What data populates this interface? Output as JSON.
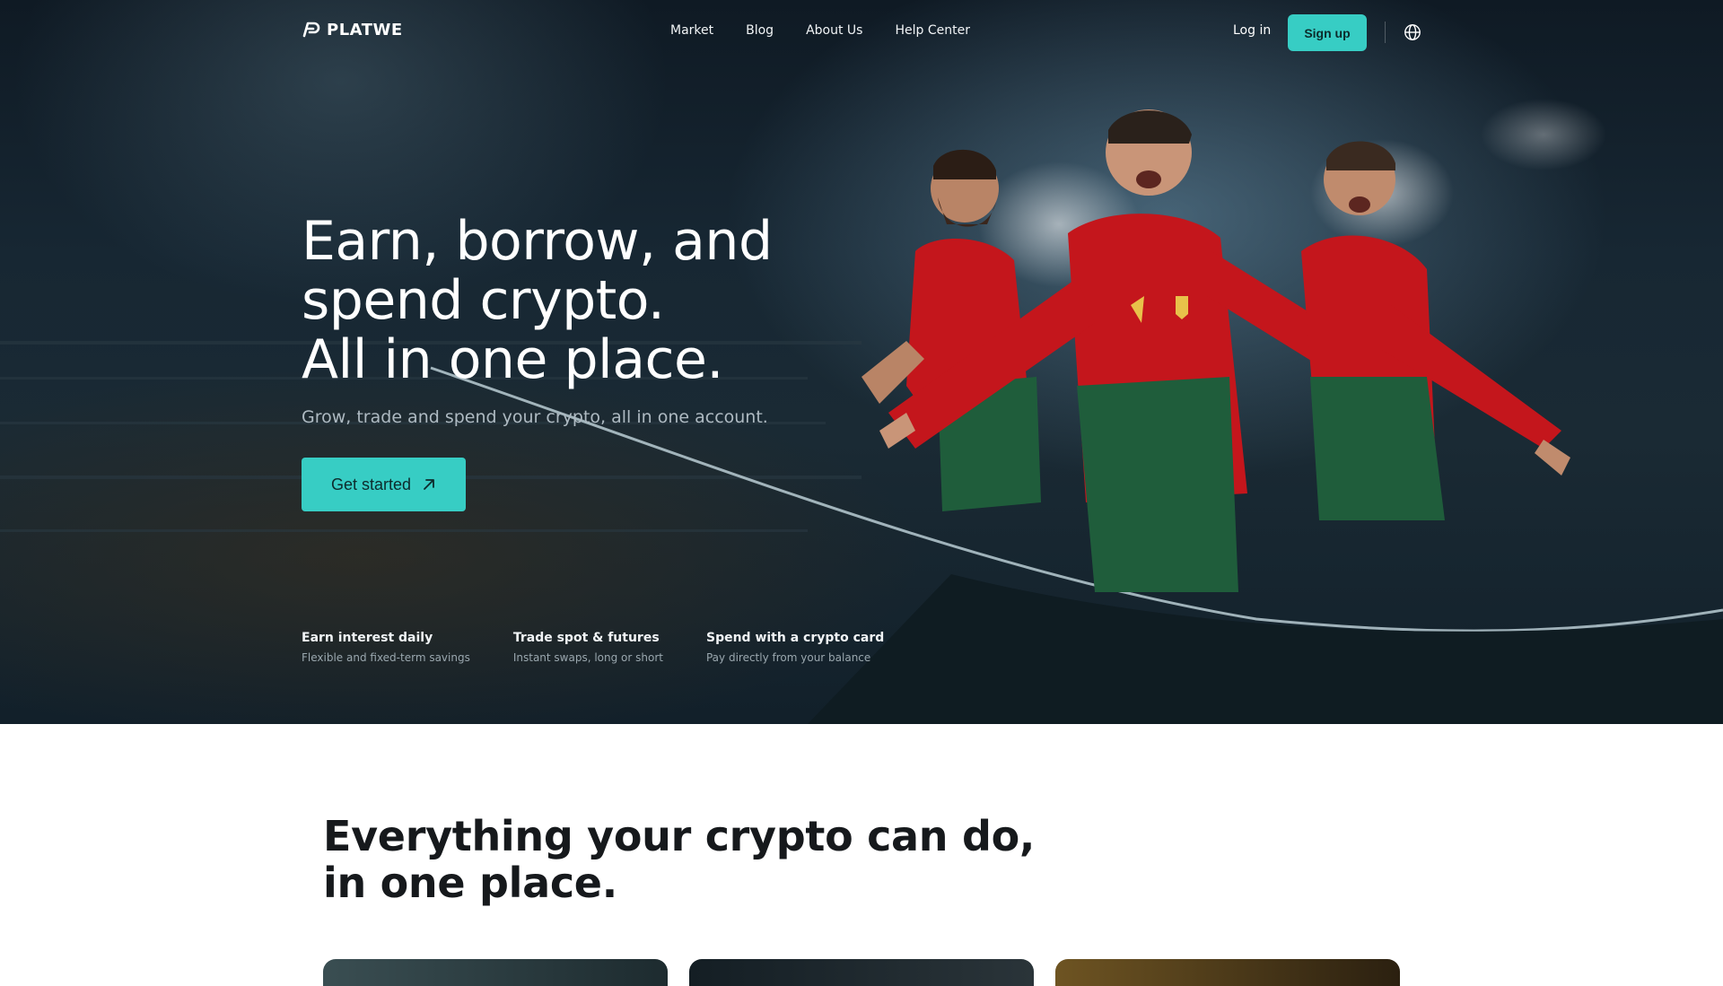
{
  "brand": {
    "name": "PLATWE",
    "logo_icon": "platwe-logo-icon"
  },
  "nav": {
    "links": [
      "Market",
      "Blog",
      "About Us",
      "Help Center"
    ],
    "login_label": "Log in",
    "signup_label": "Sign up",
    "language_icon": "globe-icon"
  },
  "hero": {
    "headline_lines": [
      "Earn, borrow, and",
      "spend crypto.",
      "All in one place."
    ],
    "subtext": "Grow, trade and spend your crypto, all in one account.",
    "cta_label": "Get started",
    "cta_icon": "arrow-up-right-icon",
    "features": [
      {
        "title": "Earn interest daily",
        "desc": "Flexible and fixed-term savings"
      },
      {
        "title": "Trade spot & futures",
        "desc": "Instant swaps, long or short"
      },
      {
        "title": "Spend with a crypto card",
        "desc": "Pay directly from your balance"
      }
    ],
    "image": "football-players-celebrating-image"
  },
  "section2": {
    "title_lines": [
      "Everything your crypto can do,",
      "in one place."
    ]
  },
  "colors": {
    "accent": "#37cdc4",
    "hero_bg": "#172733",
    "jersey_red": "#c4161c",
    "jersey_green": "#1f5d3b"
  }
}
